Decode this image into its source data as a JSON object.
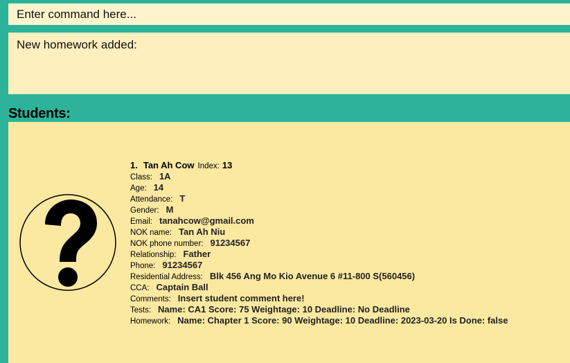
{
  "command": {
    "placeholder": "Enter command here..."
  },
  "result": {
    "text": "New homework added:"
  },
  "students_header": "Students:",
  "colors": {
    "background": "#2db39a",
    "command_box": "#fdf4cd",
    "result_box": "#fdefbe",
    "list_panel": "#fbe8a1"
  },
  "avatar": {
    "icon": "question-mark-icon"
  },
  "student": {
    "number": "1.",
    "name": "Tan Ah Cow",
    "index_label": "Index:",
    "index": "13",
    "fields": [
      {
        "label": "Class:",
        "value": "1A"
      },
      {
        "label": "Age:",
        "value": "14"
      },
      {
        "label": "Attendance:",
        "value": "T"
      },
      {
        "label": "Gender:",
        "value": "M"
      },
      {
        "label": "Email:",
        "value": "tanahcow@gmail.com"
      },
      {
        "label": "NOK name:",
        "value": "Tan Ah Niu"
      },
      {
        "label": "NOK phone number:",
        "value": "91234567"
      },
      {
        "label": "Relationship:",
        "value": "Father"
      },
      {
        "label": "Phone:",
        "value": "91234567"
      },
      {
        "label": "Residential Address:",
        "value": "Blk 456 Ang Mo Kio Avenue 6 #11-800 S(560456)"
      },
      {
        "label": "CCA:",
        "value": "Captain Ball"
      },
      {
        "label": "Comments:",
        "value": "Insert student comment here!"
      },
      {
        "label": "Tests:",
        "value": "Name: CA1 Score: 75 Weightage: 10 Deadline: No Deadline"
      },
      {
        "label": "Homework:",
        "value": "Name: Chapter 1 Score: 90 Weightage: 10 Deadline: 2023-03-20 Is Done: false"
      }
    ]
  }
}
